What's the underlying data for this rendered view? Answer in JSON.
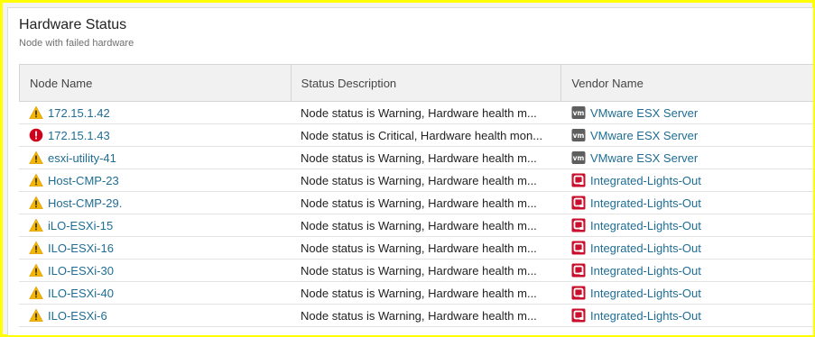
{
  "widget": {
    "title": "Hardware Status",
    "subtitle": "Node with failed hardware"
  },
  "table": {
    "columns": [
      "Node Name",
      "Status Description",
      "Vendor Name"
    ],
    "rows": [
      {
        "node": "172.15.1.42",
        "status_icon": "warning-icon",
        "description": "Node status is Warning, Hardware health m...",
        "vendor_icon": "vmware-icon",
        "vendor": "VMware ESX Server"
      },
      {
        "node": "172.15.1.43",
        "status_icon": "critical-icon",
        "description": "Node status is Critical, Hardware health mon...",
        "vendor_icon": "vmware-icon",
        "vendor": "VMware ESX Server"
      },
      {
        "node": "esxi-utility-41",
        "status_icon": "warning-icon",
        "description": "Node status is Warning, Hardware health m...",
        "vendor_icon": "vmware-icon",
        "vendor": "VMware ESX Server"
      },
      {
        "node": "Host-CMP-23",
        "status_icon": "warning-icon",
        "description": "Node status is Warning, Hardware health m...",
        "vendor_icon": "ilo-icon",
        "vendor": "Integrated-Lights-Out"
      },
      {
        "node": "Host-CMP-29.",
        "status_icon": "warning-icon",
        "description": "Node status is Warning, Hardware health m...",
        "vendor_icon": "ilo-icon",
        "vendor": "Integrated-Lights-Out"
      },
      {
        "node": "iLO-ESXi-15",
        "status_icon": "warning-icon",
        "description": "Node status is Warning, Hardware health m...",
        "vendor_icon": "ilo-icon",
        "vendor": "Integrated-Lights-Out"
      },
      {
        "node": "ILO-ESXi-16",
        "status_icon": "warning-icon",
        "description": "Node status is Warning, Hardware health m...",
        "vendor_icon": "ilo-icon",
        "vendor": "Integrated-Lights-Out"
      },
      {
        "node": "ILO-ESXi-30",
        "status_icon": "warning-icon",
        "description": "Node status is Warning, Hardware health m...",
        "vendor_icon": "ilo-icon",
        "vendor": "Integrated-Lights-Out"
      },
      {
        "node": "ILO-ESXi-40",
        "status_icon": "warning-icon",
        "description": "Node status is Warning, Hardware health m...",
        "vendor_icon": "ilo-icon",
        "vendor": "Integrated-Lights-Out"
      },
      {
        "node": "ILO-ESXi-6",
        "status_icon": "warning-icon",
        "description": "Node status is Warning, Hardware health m...",
        "vendor_icon": "ilo-icon",
        "vendor": "Integrated-Lights-Out"
      }
    ]
  },
  "colors": {
    "link": "#1f6d94",
    "warning": "#f5b700",
    "critical": "#d0021b",
    "vmware": "#5e5e5e",
    "ilo": "#c8102e",
    "highlight_border": "#ffff00"
  }
}
